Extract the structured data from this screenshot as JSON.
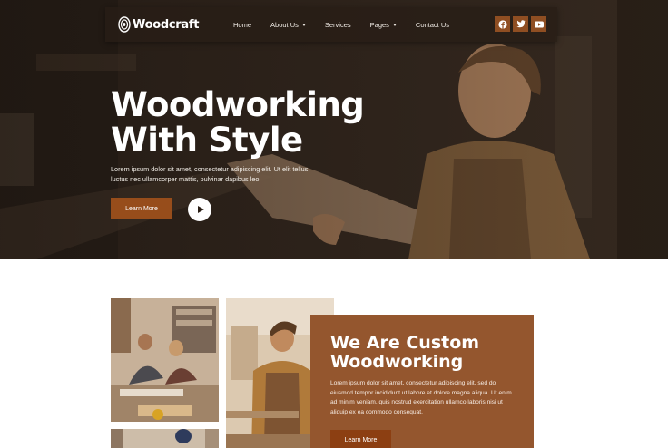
{
  "brand": {
    "name": "Woodcraft",
    "logo_icon": "wood-grain-icon"
  },
  "nav": {
    "items": [
      {
        "label": "Home",
        "has_dropdown": false
      },
      {
        "label": "About Us",
        "has_dropdown": true
      },
      {
        "label": "Services",
        "has_dropdown": false
      },
      {
        "label": "Pages",
        "has_dropdown": true
      },
      {
        "label": "Contact Us",
        "has_dropdown": false
      }
    ],
    "socials": [
      {
        "icon": "facebook-icon"
      },
      {
        "icon": "twitter-icon"
      },
      {
        "icon": "youtube-icon"
      }
    ]
  },
  "hero": {
    "title": "Woodworking\nWith Style",
    "description": "Lorem ipsum dolor sit amet, consectetur adipiscing elit. Ut elit tellus, luctus nec ullamcorper mattis, pulvinar dapibus leo.",
    "button_label": "Learn More",
    "play_icon": "play-icon"
  },
  "about": {
    "title": "We Are Custom\nWoodworking",
    "text": "Lorem ipsum dolor sit amet, consectetur adipiscing elit, sed do eiusmod tempor incididunt ut labore et dolore magna aliqua. Ut enim ad minim veniam, quis nostrud exercitation ullamco laboris nisi ut aliquip ex ea commodo consequat.",
    "button_label": "Learn More"
  },
  "colors": {
    "accent": "#974d1b",
    "card": "#94562e",
    "hero_dark": "#2b221b"
  }
}
